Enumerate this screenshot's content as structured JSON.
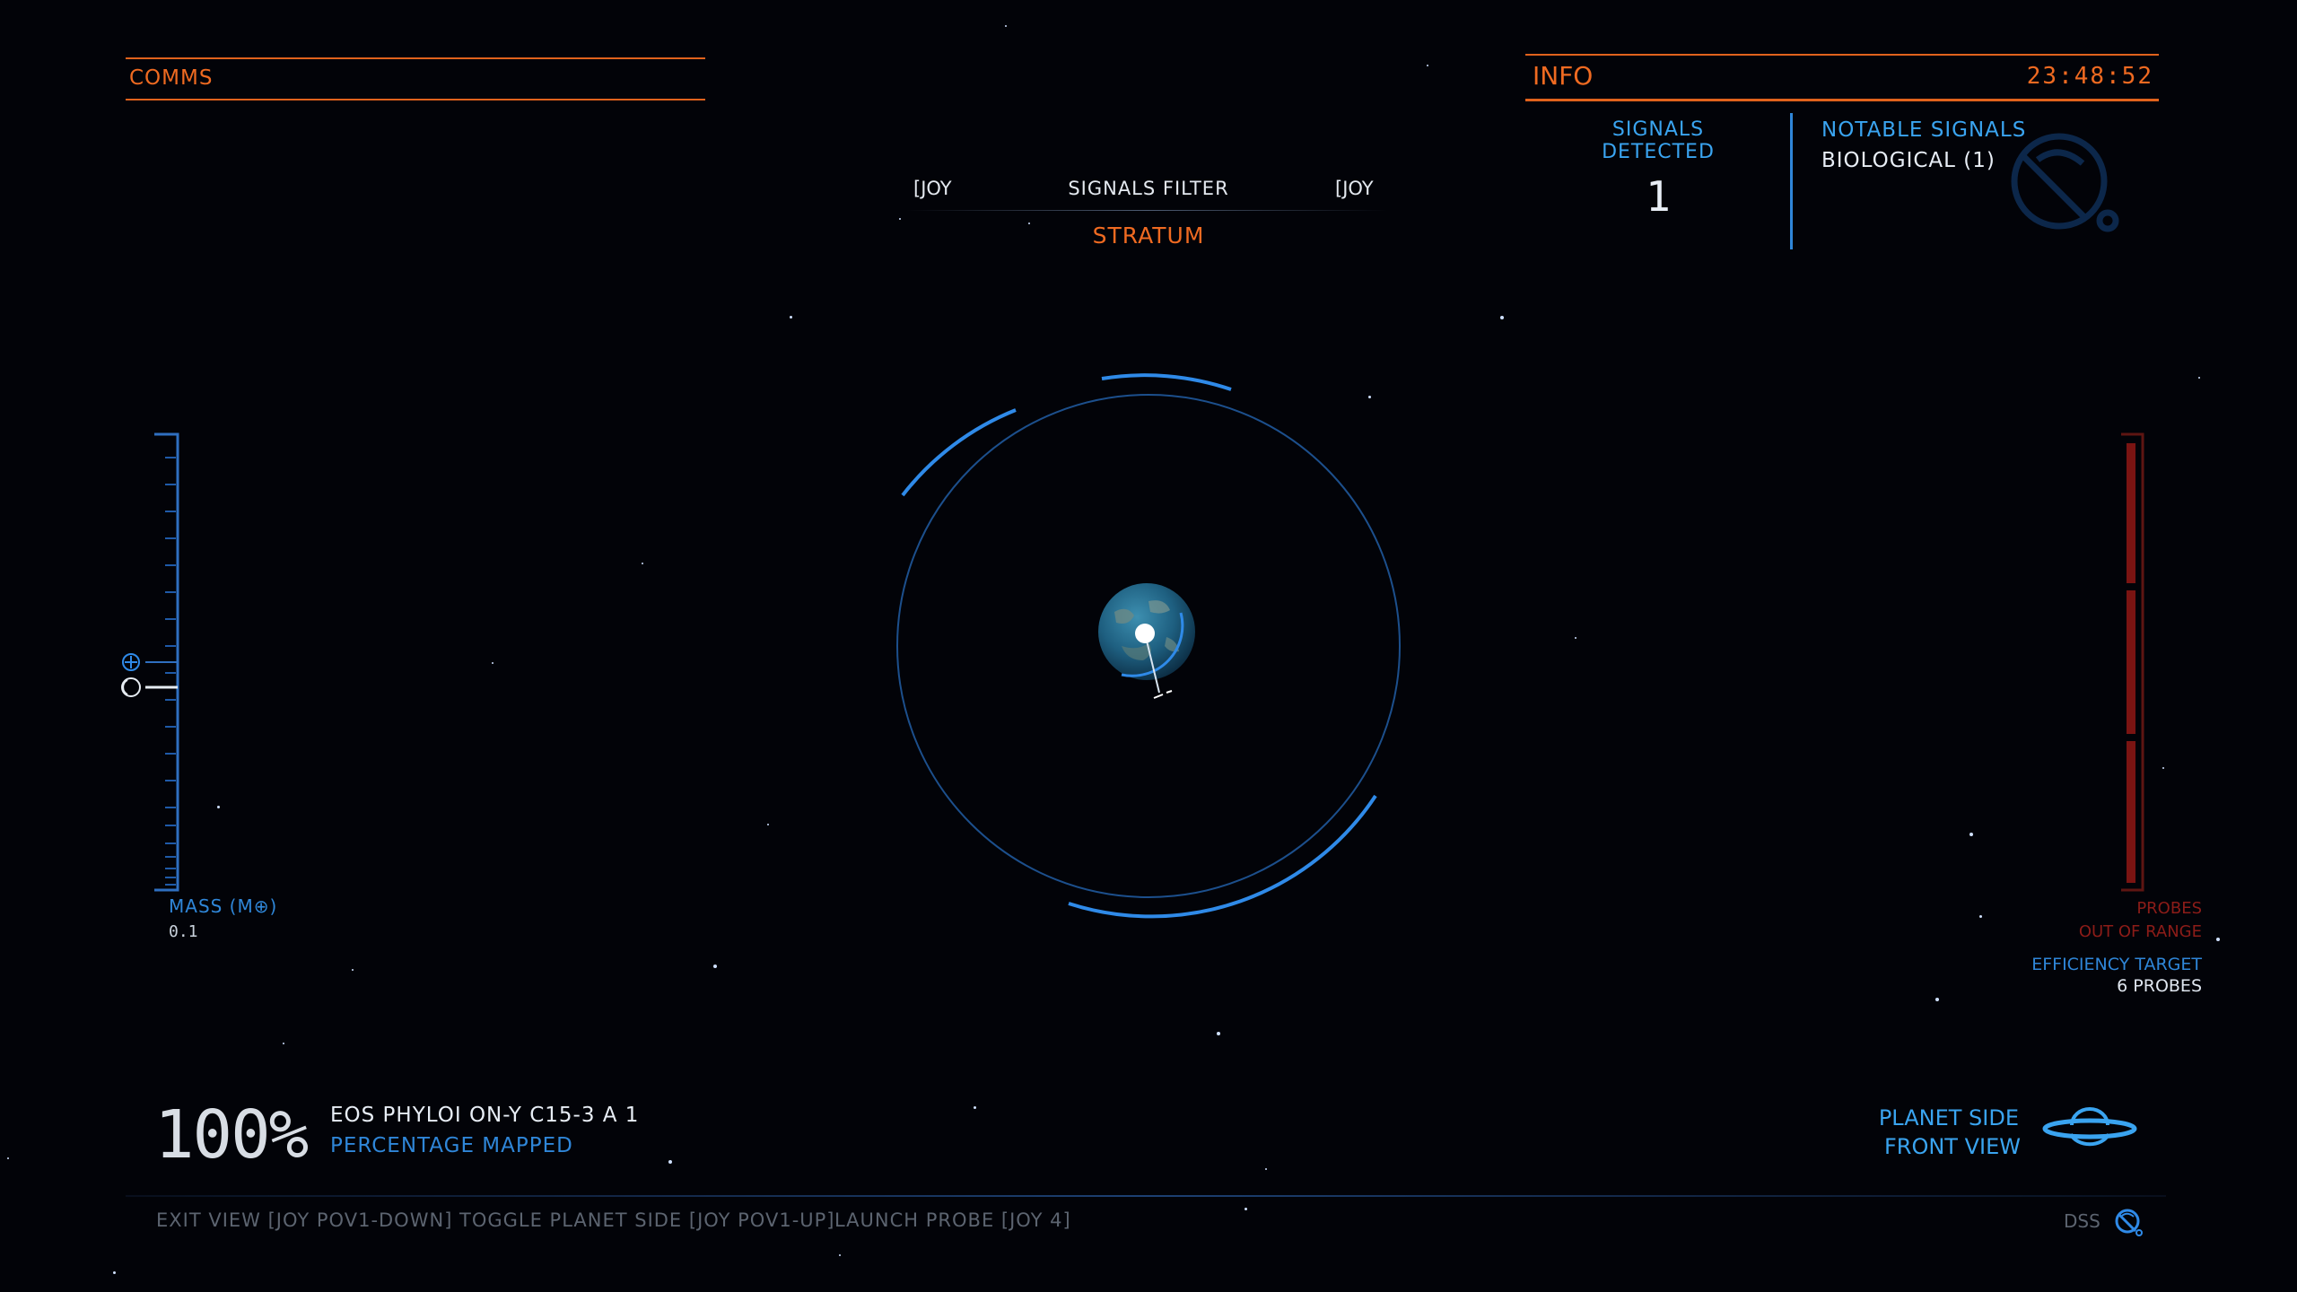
{
  "comms": {
    "label": "COMMS"
  },
  "info": {
    "label": "INFO",
    "clock": "23:48:52",
    "signals_detected_label": "SIGNALS DETECTED",
    "signals_detected_count": "1",
    "notable_signals_label": "NOTABLE SIGNALS",
    "notable_signals": [
      "BIOLOGICAL (1)"
    ]
  },
  "signals_filter": {
    "left_key": "[JOY",
    "title": "SIGNALS FILTER",
    "right_key": "[JOY",
    "value": "STRATUM"
  },
  "mass_gauge": {
    "label": "MASS (M⊕)",
    "value": "0.1"
  },
  "probe_gauge": {
    "status_line1": "PROBES",
    "status_line2": "OUT OF RANGE",
    "efficiency_label": "EFFICIENCY TARGET",
    "efficiency_value": "6 PROBES"
  },
  "mapping": {
    "percent": "100%",
    "body_name": "EOS PHYLOI ON-Y C15-3 A 1",
    "percent_label": "PERCENTAGE MAPPED"
  },
  "view": {
    "line1": "PLANET SIDE",
    "line2": "FRONT VIEW"
  },
  "hints": [
    "EXIT VIEW [JOY POV1-DOWN]",
    "TOGGLE PLANET SIDE [JOY POV1-UP]",
    "LAUNCH PROBE [JOY 4]"
  ],
  "dss_label": "DSS",
  "colors": {
    "orange": "#ef6a21",
    "blue": "#3aa4f0",
    "probe_red": "#8c1c18",
    "background": "#020308"
  },
  "icons": [
    "surface-scanner-icon",
    "ring-planet-icon",
    "mass-earth-icon",
    "moon-icon",
    "dss-icon"
  ]
}
